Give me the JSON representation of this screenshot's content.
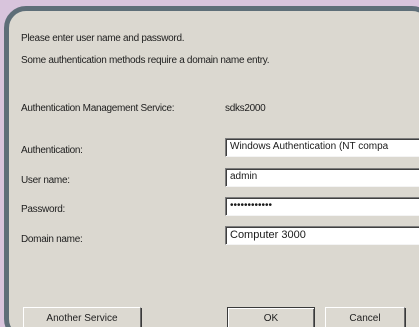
{
  "dialog": {
    "prompt": "Please enter user name and password.",
    "note": "Some authentication methods require a domain name entry.",
    "service_label": "Authentication Management Service:",
    "service_value": "sdks2000"
  },
  "form": {
    "authentication_label": "Authentication:",
    "authentication_value": "Windows Authentication (NT compa",
    "username_label": "User name:",
    "username_value": "admin",
    "password_label": "Password:",
    "password_value": "••••••••••••",
    "domain_label": "Domain name:",
    "domain_value": "Computer 3000"
  },
  "buttons": {
    "another_service": "Another Service",
    "ok": "OK",
    "cancel": "Cancel"
  }
}
